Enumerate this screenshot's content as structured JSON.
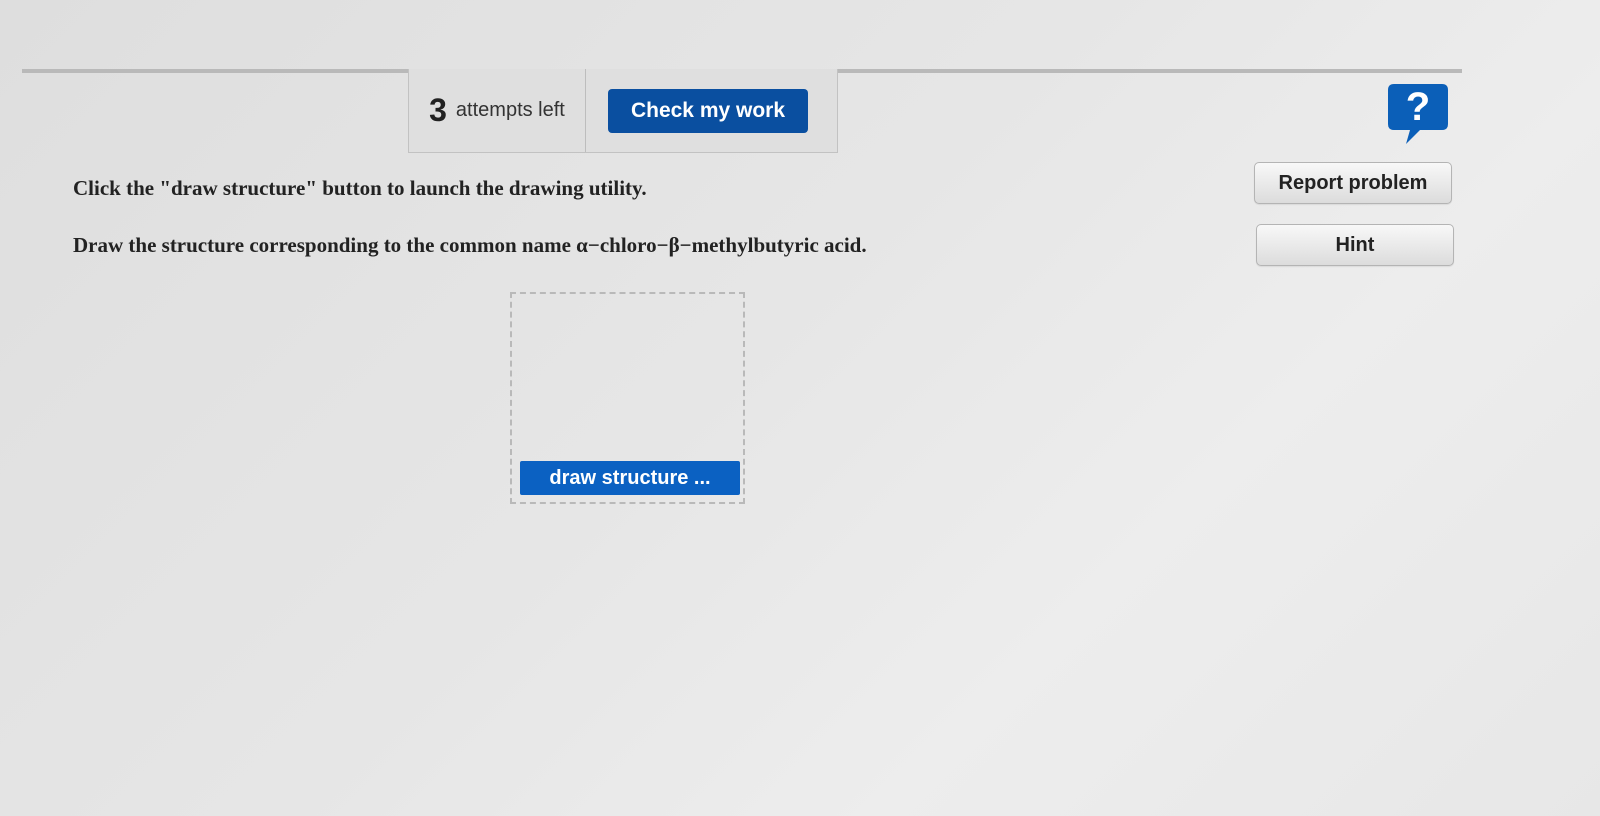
{
  "toolbar": {
    "attempts_count": "3",
    "attempts_label": "attempts left",
    "check_label": "Check my work"
  },
  "sidebar": {
    "help_symbol": "?",
    "help_icon": "help-icon",
    "report_label": "Report problem",
    "hint_label": "Hint"
  },
  "content": {
    "instruction": "Click the \"draw structure\" button to launch the drawing utility.",
    "question": "Draw the structure corresponding to the common name α−chloro−β−methylbutyric acid.",
    "draw_label": "draw structure ..."
  },
  "colors": {
    "primary_button": "#0a4fa0",
    "draw_button": "#0b61c2",
    "help_icon": "#0b5fb8"
  }
}
